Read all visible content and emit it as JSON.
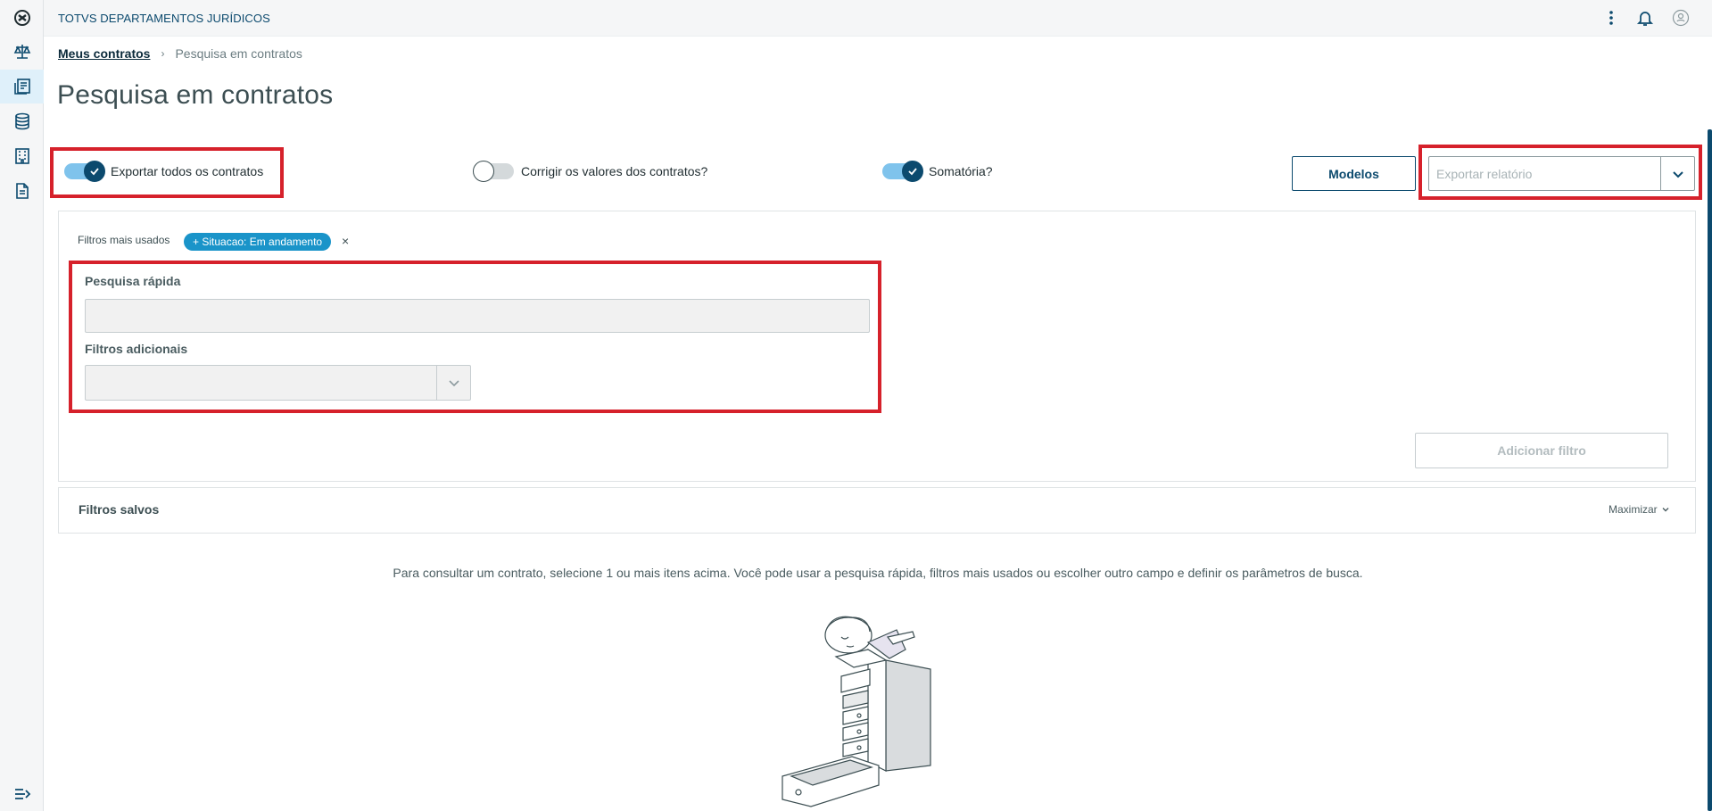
{
  "app": {
    "title": "TOTVS DEPARTAMENTOS JURÍDICOS"
  },
  "sidebar": {
    "items": [
      {
        "icon": "logo-icon"
      },
      {
        "icon": "scales-icon"
      },
      {
        "icon": "contracts-icon",
        "active": true
      },
      {
        "icon": "database-icon"
      },
      {
        "icon": "building-icon"
      },
      {
        "icon": "document-icon"
      }
    ],
    "collapse_icon": "expand-menu-icon"
  },
  "topbar": {
    "icons": [
      "more-vertical-icon",
      "bell-icon",
      "user-icon"
    ]
  },
  "breadcrumb": {
    "link": "Meus contratos",
    "current": "Pesquisa em contratos"
  },
  "page": {
    "title": "Pesquisa em contratos"
  },
  "toggles": {
    "export_all": {
      "label": "Exportar todos os contratos",
      "on": true
    },
    "correct_values": {
      "label": "Corrigir os valores dos contratos?",
      "on": false
    },
    "sum": {
      "label": "Somatória?",
      "on": true
    }
  },
  "buttons": {
    "models": "Modelos",
    "add_filter": "Adicionar filtro"
  },
  "export_report": {
    "placeholder": "Exportar relatório"
  },
  "filters": {
    "most_used_label": "Filtros mais usados",
    "chip": "+ Situacao: Em andamento",
    "chip_remove": "×",
    "quick_search_label": "Pesquisa rápida",
    "quick_search_value": "",
    "additional_label": "Filtros adicionais",
    "additional_value": ""
  },
  "saved_filters": {
    "title": "Filtros salvos",
    "maximize": "Maximizar"
  },
  "help": {
    "text": "Para consultar um contrato, selecione 1 ou mais itens acima. Você pode usar a pesquisa rápida, filtros mais usados ou escolher outro campo e definir os parâmetros de busca."
  },
  "colors": {
    "primary": "#0c4a6e",
    "accent": "#1a94c9",
    "highlight": "#d6212b",
    "toggle_on": "#7fc3ec"
  }
}
